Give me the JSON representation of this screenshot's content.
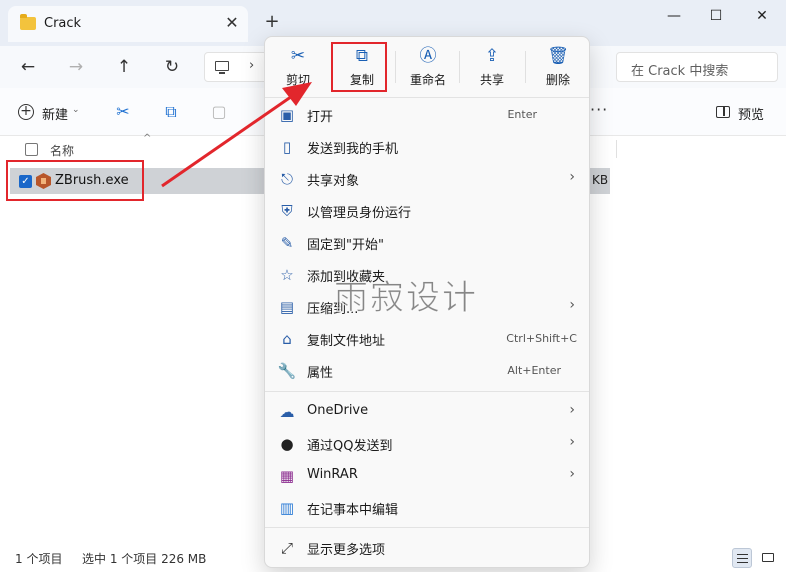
{
  "window": {
    "tab_title": "Crack",
    "tab_close_glyph": "✕",
    "new_tab_glyph": "+",
    "minimize_glyph": "—",
    "maximize_glyph": "☐",
    "close_glyph": "✕"
  },
  "nav": {
    "back_glyph": "←",
    "forward_glyph": "→",
    "up_glyph": "↑",
    "refresh_glyph": "↻",
    "address_chevron": "›",
    "search_placeholder": "在 Crack 中搜索"
  },
  "commandbar": {
    "new_label": "新建",
    "new_caret": "⌄",
    "more_glyph": "···",
    "preview_label": "预览",
    "icons": [
      "cut-icon",
      "copy-icon",
      "paste-icon"
    ]
  },
  "list": {
    "header_name": "名称",
    "sort_glyph": "^",
    "rows": [
      {
        "name": "ZBrush.exe",
        "size_suffix": "KB",
        "selected": true
      }
    ]
  },
  "status": {
    "item_count": "1 个项目",
    "selection": "选中 1 个项目  226 MB"
  },
  "context_menu": {
    "toolbar": [
      {
        "label": "剪切",
        "icon": "cut-icon",
        "glyph": "✂"
      },
      {
        "label": "复制",
        "icon": "copy-icon",
        "glyph": "⧉"
      },
      {
        "label": "重命名",
        "icon": "rename-icon",
        "glyph": "Ⓐ"
      },
      {
        "label": "共享",
        "icon": "share-icon",
        "glyph": "⇪"
      },
      {
        "label": "删除",
        "icon": "trash-icon",
        "glyph": "🗑"
      }
    ],
    "items": [
      {
        "label": "打开",
        "shortcut": "Enter",
        "icon": "open-icon",
        "glyph": "▣"
      },
      {
        "label": "发送到我的手机",
        "icon": "phone-icon",
        "glyph": "▯"
      },
      {
        "label": "共享对象",
        "submenu": true,
        "icon": "share-target-icon",
        "glyph": "⎋"
      },
      {
        "label": "以管理员身份运行",
        "icon": "shield-icon",
        "glyph": "⛨"
      },
      {
        "label": "固定到\"开始\"",
        "icon": "pin-icon",
        "glyph": "✎"
      },
      {
        "label": "添加到收藏夹",
        "icon": "star-icon",
        "glyph": "☆"
      },
      {
        "label": "压缩到...",
        "submenu": true,
        "icon": "archive-icon",
        "glyph": "▤"
      },
      {
        "label": "复制文件地址",
        "shortcut": "Ctrl+Shift+C",
        "icon": "copy-path-icon",
        "glyph": "⌂"
      },
      {
        "label": "属性",
        "shortcut": "Alt+Enter",
        "icon": "wrench-icon",
        "glyph": "🔧"
      },
      {
        "label": "OneDrive",
        "submenu": true,
        "icon": "cloud-icon",
        "glyph": "☁"
      },
      {
        "label": "通过QQ发送到",
        "submenu": true,
        "icon": "qq-icon",
        "glyph": "●"
      },
      {
        "label": "WinRAR",
        "submenu": true,
        "icon": "winrar-icon",
        "glyph": "▦"
      },
      {
        "label": "在记事本中编辑",
        "icon": "notepad-icon",
        "glyph": "▥"
      },
      {
        "label": "显示更多选项",
        "icon": "more-options-icon",
        "glyph": "⤢"
      }
    ],
    "chevron_glyph": "›"
  },
  "watermark": {
    "text": "雨寂设计"
  },
  "colors": {
    "accent": "#1a67c9",
    "highlight_red": "#e2262c",
    "selected_row": "#cfd2d6",
    "menu_bg": "#f9f9f9"
  }
}
